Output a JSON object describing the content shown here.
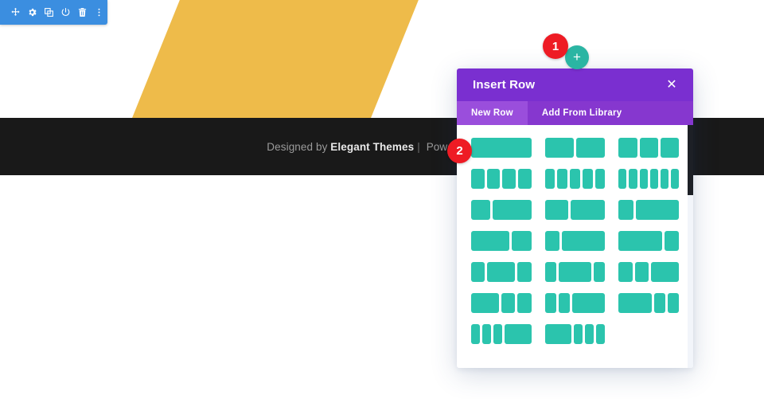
{
  "toolbar": {
    "name": "divi-builder-toolbar",
    "background": "#3b8ee0",
    "buttons": [
      {
        "icon": "move-icon",
        "label": "Move"
      },
      {
        "icon": "gear-icon",
        "label": "Settings"
      },
      {
        "icon": "duplicate-icon",
        "label": "Duplicate"
      },
      {
        "icon": "power-icon",
        "label": "Enable/Disable"
      },
      {
        "icon": "trash-icon",
        "label": "Delete"
      },
      {
        "icon": "more-vertical-icon",
        "label": "More Options"
      }
    ]
  },
  "page": {
    "shape": {
      "name": "yellow-parallelogram",
      "color": "#eebb4a"
    },
    "footer": {
      "prefix": "Designed by ",
      "brand": "Elegant Themes",
      "separator": "|",
      "suffix": " Powered by W",
      "background": "#191919"
    }
  },
  "add_row_button": {
    "icon": "plus-icon",
    "glyph": "+",
    "color": "#2bb5a3"
  },
  "modal": {
    "title": "Insert Row",
    "close_label": "✕",
    "header_color": "#7a2fd0",
    "tabbar_color": "#8637cf",
    "active_tab_color": "#9a4edc",
    "tabs": [
      {
        "label": "New Row",
        "active": true
      },
      {
        "label": "Add From Library",
        "active": false
      }
    ],
    "column_color": "#2bc4ad",
    "layouts": [
      {
        "name": "1-column",
        "columns": [
          1
        ]
      },
      {
        "name": "2-columns-equal",
        "columns": [
          1,
          1
        ]
      },
      {
        "name": "3-columns-equal",
        "columns": [
          1,
          1,
          1
        ]
      },
      {
        "name": "4-columns-equal",
        "columns": [
          1,
          1,
          1,
          1
        ]
      },
      {
        "name": "5-columns-equal",
        "columns": [
          1,
          1,
          1,
          1,
          1
        ]
      },
      {
        "name": "6-columns-equal",
        "columns": [
          1,
          1,
          1,
          1,
          1,
          1
        ]
      },
      {
        "name": "one-third-two-thirds",
        "columns": [
          1,
          2
        ]
      },
      {
        "name": "two-fifths-three-fifths",
        "columns": [
          2,
          3
        ]
      },
      {
        "name": "one-quarter-three-quarters",
        "columns": [
          1,
          3
        ]
      },
      {
        "name": "two-thirds-one-third",
        "columns": [
          2,
          1
        ]
      },
      {
        "name": "one-quarter-rest",
        "columns": [
          1,
          3
        ]
      },
      {
        "name": "three-quarters-one-quarter",
        "columns": [
          3,
          1
        ]
      },
      {
        "name": "quarter-half-quarter",
        "columns": [
          1,
          2,
          1
        ]
      },
      {
        "name": "fifth-three-fifths-fifth",
        "columns": [
          1,
          3,
          1
        ]
      },
      {
        "name": "quarter-quarter-half",
        "columns": [
          1,
          1,
          2
        ]
      },
      {
        "name": "half-quarter-quarter",
        "columns": [
          2,
          1,
          1
        ]
      },
      {
        "name": "fifth-fifth-three-fifths",
        "columns": [
          1,
          1,
          3
        ]
      },
      {
        "name": "three-fifths-fifth-fifth",
        "columns": [
          3,
          1,
          1
        ]
      },
      {
        "name": "sixth-sixth-sixth-half",
        "columns": [
          1,
          1,
          1,
          3
        ]
      },
      {
        "name": "half-sixth-sixth-sixth",
        "columns": [
          3,
          1,
          1,
          1
        ]
      }
    ],
    "scrollbar": {
      "track_color": "#f2f5fa",
      "thumb_color": "#1d2026"
    }
  },
  "badges": [
    {
      "number": "1",
      "color": "#ee1b24"
    },
    {
      "number": "2",
      "color": "#ee1b24"
    }
  ]
}
